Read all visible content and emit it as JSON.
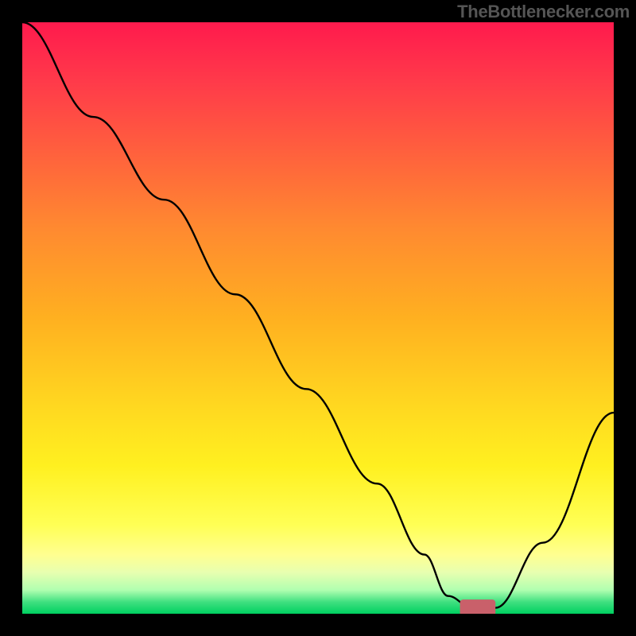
{
  "watermark": {
    "text": "TheBottlenecker.com"
  },
  "chart_data": {
    "type": "line",
    "title": "",
    "xlabel": "",
    "ylabel": "",
    "xlim": [
      0,
      100
    ],
    "ylim": [
      0,
      100
    ],
    "grid": false,
    "x": [
      0,
      12,
      24,
      36,
      48,
      60,
      68,
      72,
      76,
      80,
      88,
      100
    ],
    "values": [
      100,
      84,
      70,
      54,
      38,
      22,
      10,
      3,
      1,
      1,
      12,
      34
    ],
    "marker": {
      "x": 77,
      "y": 1,
      "color": "#c9606a",
      "width": 6,
      "height": 2
    },
    "background_gradient": {
      "stops": [
        {
          "pos": 0,
          "color": "#ff1a4d"
        },
        {
          "pos": 50,
          "color": "#ffb020"
        },
        {
          "pos": 85,
          "color": "#ffff55"
        },
        {
          "pos": 100,
          "color": "#00d060"
        }
      ]
    }
  }
}
